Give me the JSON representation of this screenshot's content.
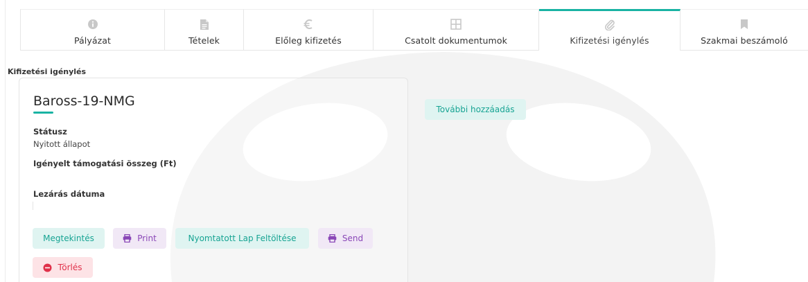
{
  "tabs": [
    {
      "label": "Pályázat",
      "icon": "info-circle-icon",
      "active": false
    },
    {
      "label": "Tételek",
      "icon": "document-icon",
      "active": false
    },
    {
      "label": "Előleg kifizetés",
      "icon": "euro-icon",
      "active": false
    },
    {
      "label": "Csatolt dokumentumok",
      "icon": "grid-icon",
      "active": false
    },
    {
      "label": "Kifizetési igénylés",
      "icon": "paperclip-icon",
      "active": true
    },
    {
      "label": "Szakmai beszámoló",
      "icon": "bookmark-icon",
      "active": false
    }
  ],
  "section": {
    "title": "Kifizetési igénylés"
  },
  "card": {
    "title": "Baross-19-NMG",
    "status_label": "Státusz",
    "status_value": "Nyitott állapot",
    "amount_label": "Igényelt támogatási összeg (Ft)",
    "amount_value": "",
    "close_date_label": "Lezárás dátuma",
    "close_date_value": ""
  },
  "actions": {
    "view": "Megtekintés",
    "print": "Print",
    "upload_printed": "Nyomtatott Lap Feltöltése",
    "send": "Send",
    "delete": "Törlés"
  },
  "extra": {
    "add_more": "További hozzáadás"
  },
  "colors": {
    "accent": "#19b3a3",
    "teal_bg": "#dff4f1",
    "purple": "#8a47b7",
    "purple_bg": "#f1e8f6",
    "red": "#e0314a",
    "red_bg": "#fde3e6"
  }
}
